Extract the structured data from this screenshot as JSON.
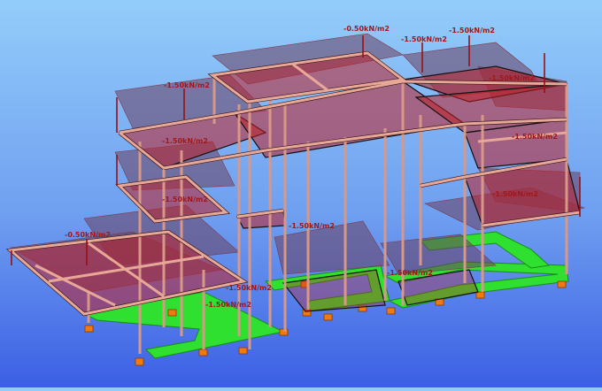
{
  "viewport": {
    "name": "3D structural model view"
  },
  "load_labels": [
    "-0.50kN/m2",
    "-1.50kN/m2",
    "-1.50kN/m2",
    "-1.50kN/m2",
    "-1.50kN/m2",
    "-1.50kN/m2",
    "-1.50kN/m2",
    "-1.50kN/m2",
    "-1.50kN/m2",
    "-0.50kN/m2",
    "-1.50kN/m2",
    "-1.50kN/m2",
    "-1.50kN/m2",
    "-1.50kN/m2"
  ],
  "colors": {
    "slab": "#c02028",
    "beam": "#e8a898",
    "foundation": "#30e030",
    "support": "#f07a10",
    "load_label": "#a01818"
  }
}
